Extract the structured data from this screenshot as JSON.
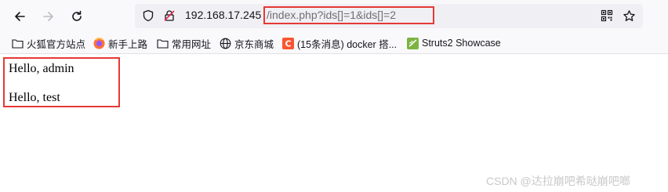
{
  "browser": {
    "back_icon": "arrow-left-icon",
    "forward_icon": "arrow-right-icon",
    "reload_icon": "reload-icon",
    "url_host": "192.168.17.245",
    "url_path": "/index.php?ids[]=1&ids[]=2",
    "highlight_color": "#e53935"
  },
  "bookmarks": [
    {
      "label": "火狐官方站点",
      "icon": "folder-icon"
    },
    {
      "label": "新手上路",
      "icon": "firefox-icon"
    },
    {
      "label": "常用网址",
      "icon": "folder-icon"
    },
    {
      "label": "京东商城",
      "icon": "globe-icon"
    },
    {
      "label": "(15条消息) docker 搭...",
      "icon": "csdn-icon"
    },
    {
      "label": "Struts2 Showcase",
      "icon": "struts-icon"
    }
  ],
  "content": {
    "line1": "Hello, admin",
    "line2": "Hello, test"
  },
  "watermark": "CSDN @达拉崩吧希哒崩吧啷"
}
